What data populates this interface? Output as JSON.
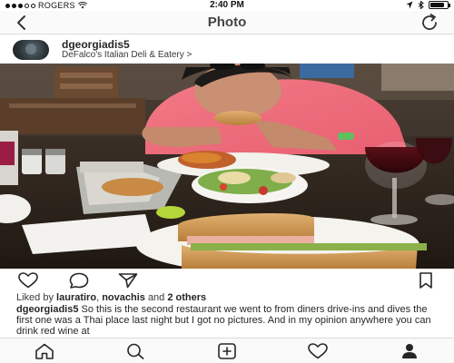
{
  "status_bar": {
    "carrier": "ROGERS",
    "time": "2:40 PM",
    "battery_level": 0.85
  },
  "nav": {
    "title": "Photo",
    "back_icon": "chevron-left-icon",
    "refresh_icon": "refresh-icon"
  },
  "post": {
    "username": "dgeorgiadis5",
    "location": "DeFalco's Italian Deli & Eatery",
    "location_chevron": ">",
    "likes_prefix": "Liked by",
    "liked_by_1": "lauratiro",
    "separator": ",",
    "liked_by_2": "novachis",
    "and_text": "and",
    "others": "2 others",
    "caption_user": "dgeorgiadis5",
    "caption_text": "So this is the second restaurant we went to from diners drive-ins and dives the first one was a Thai place last night but I got no pictures. And in my opinion anywhere you can drink red wine at"
  },
  "actions": {
    "icons": [
      "heart-icon",
      "comment-icon",
      "share-icon",
      "bookmark-icon"
    ]
  },
  "tab_bar": {
    "icons": [
      "home-icon",
      "search-icon",
      "camera-icon",
      "activity-icon",
      "profile-icon"
    ]
  }
}
